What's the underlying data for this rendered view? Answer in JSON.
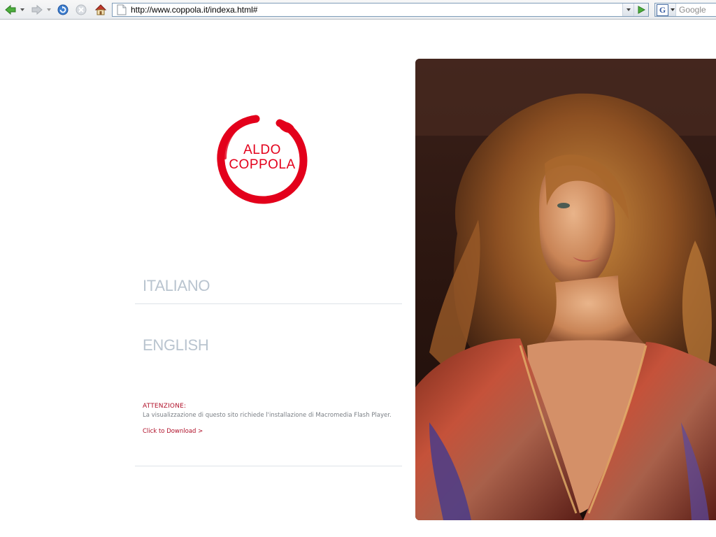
{
  "browser": {
    "url": "http://www.coppola.it/indexa.html#",
    "search_placeholder": "Google",
    "icons": [
      "back-arrow-icon",
      "forward-arrow-icon",
      "reload-icon",
      "stop-icon",
      "home-icon",
      "page-icon",
      "go-arrow-icon",
      "google-icon"
    ]
  },
  "logo": {
    "line1": "ALDO",
    "line2": "COPPOLA",
    "color": "#e3001b"
  },
  "languages": {
    "italian": "ITALIANO",
    "english": "ENGLISH"
  },
  "notice": {
    "title": "ATTENZIONE:",
    "text": "La visualizzazione di questo sito richiede l'installazione di Macromedia Flash Player.",
    "download": "Click to Download >"
  },
  "colors": {
    "accent": "#b01029",
    "lang": "#b9c4cf"
  }
}
